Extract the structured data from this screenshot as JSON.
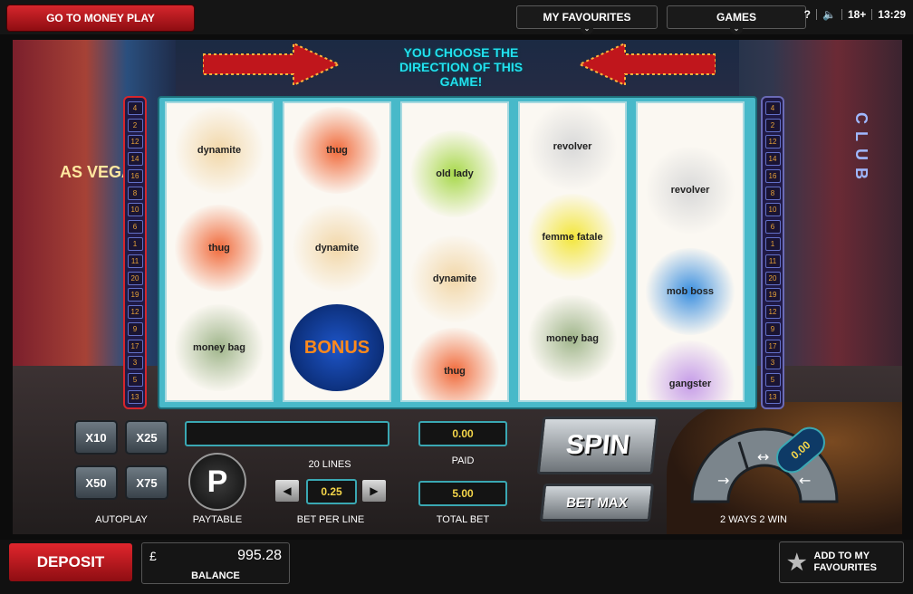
{
  "topbar": {
    "money_play_label": "GO TO MONEY PLAY",
    "favourites_label": "MY FAVOURITES",
    "games_label": "GAMES",
    "help": "?",
    "age": "18+",
    "time": "13:29"
  },
  "game": {
    "headline": "YOU CHOOSE THE DIRECTION OF THIS GAME!",
    "paylines_left": [
      "4",
      "2",
      "12",
      "14",
      "16",
      "8",
      "10",
      "6",
      "1",
      "11",
      "20",
      "19",
      "12",
      "9",
      "17",
      "3",
      "5",
      "13"
    ],
    "paylines_right": [
      "4",
      "2",
      "12",
      "14",
      "16",
      "8",
      "10",
      "6",
      "1",
      "11",
      "20",
      "19",
      "12",
      "9",
      "17",
      "3",
      "5",
      "13"
    ],
    "reels": [
      [
        "dynamite",
        "thug",
        "money bag"
      ],
      [
        "thug",
        "dynamite",
        "BONUS"
      ],
      [
        "old lady",
        "dynamite",
        "thug"
      ],
      [
        "revolver",
        "femme fatale",
        "money bag"
      ],
      [
        "revolver",
        "mob boss",
        "gangster"
      ]
    ],
    "signs": {
      "las_vegas": "AS VEGAS",
      "club": "CLUB"
    }
  },
  "controls": {
    "autoplay": {
      "x10": "X10",
      "x25": "X25",
      "x50": "X50",
      "x75": "X75",
      "label": "AUTOPLAY"
    },
    "paytable_label": "PAYTABLE",
    "lines_label": "20 LINES",
    "bet_per_line": "0.25",
    "bet_per_line_label": "BET PER LINE",
    "paid_value": "0.00",
    "paid_label": "PAID",
    "total_bet_value": "5.00",
    "total_bet_label": "TOTAL BET",
    "spin_label": "SPIN",
    "betmax_label": "BET MAX",
    "ways_value": "0.00",
    "ways_label": "2 WAYS 2 WIN"
  },
  "bottom": {
    "deposit_label": "DEPOSIT",
    "currency": "£",
    "balance_value": "995.28",
    "balance_label": "BALANCE",
    "add_favourites_label": "ADD TO MY FAVOURITES"
  },
  "colors": {
    "accent_red": "#d6262c",
    "headline_cyan": "#22e0ee",
    "value_yellow": "#f5d64a"
  }
}
